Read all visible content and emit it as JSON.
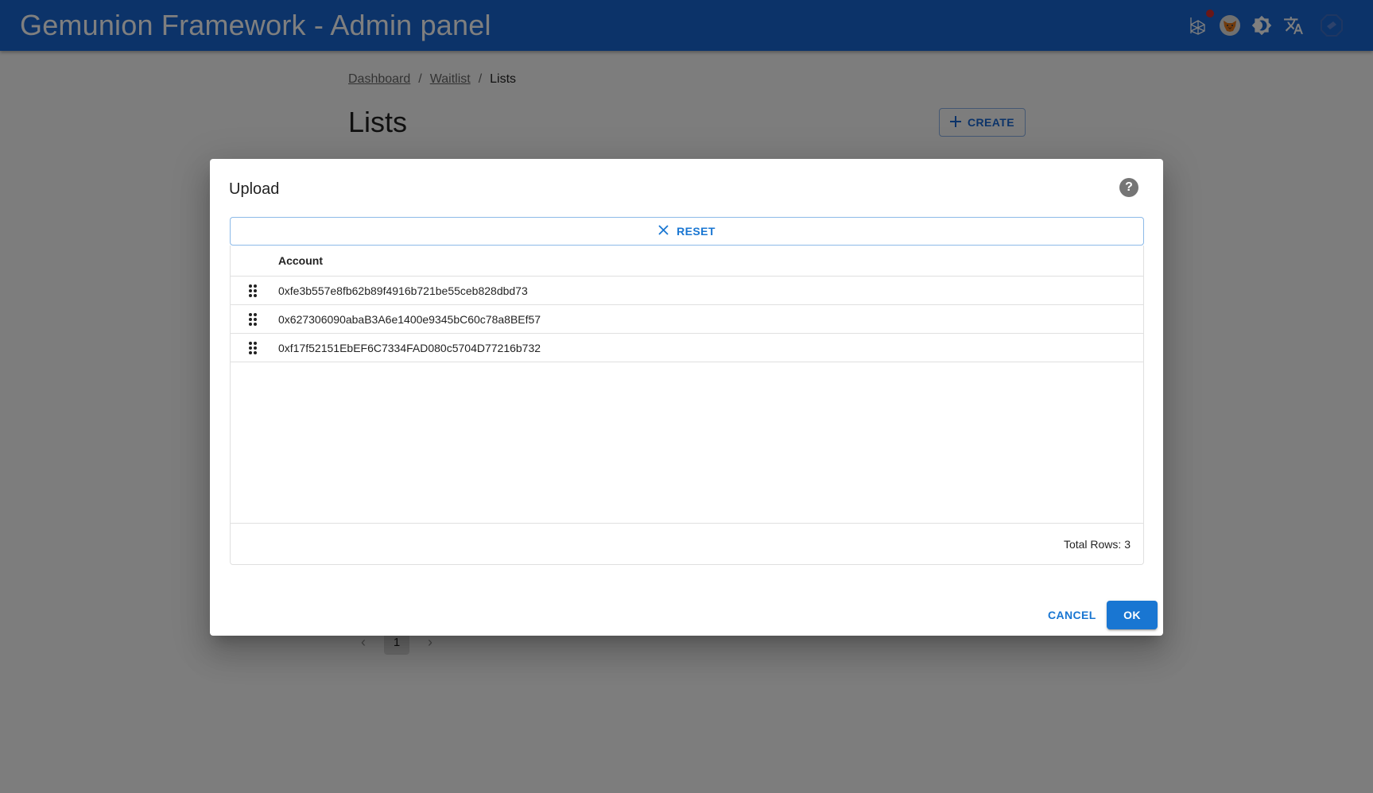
{
  "app": {
    "title": "Gemunion Framework - Admin panel",
    "icons": [
      "network-icon",
      "metamask-fox-icon",
      "theme-toggle-icon",
      "translate-icon",
      "wallet-icon"
    ],
    "brand_color": "#1967d2"
  },
  "breadcrumbs": [
    {
      "label": "Dashboard",
      "link": true
    },
    {
      "label": "Waitlist",
      "link": true
    },
    {
      "label": "Lists",
      "link": false
    }
  ],
  "breadcrumb_separator": "/",
  "page": {
    "title": "Lists",
    "create_label": "CREATE"
  },
  "pagination": {
    "current_page": "1"
  },
  "dialog": {
    "title": "Upload",
    "help_glyph": "?",
    "reset_label": "RESET",
    "table": {
      "columns": [
        "Account"
      ],
      "rows": [
        {
          "account": "0xfe3b557e8fb62b89f4916b721be55ceb828dbd73"
        },
        {
          "account": "0x627306090abaB3A6e1400e9345bC60c78a8BEf57"
        },
        {
          "account": "0xf17f52151EbEF6C7334FAD080c5704D77216b732"
        }
      ],
      "footer": "Total Rows: 3"
    },
    "cancel_label": "CANCEL",
    "ok_label": "OK",
    "accent_color": "#1976d2"
  }
}
